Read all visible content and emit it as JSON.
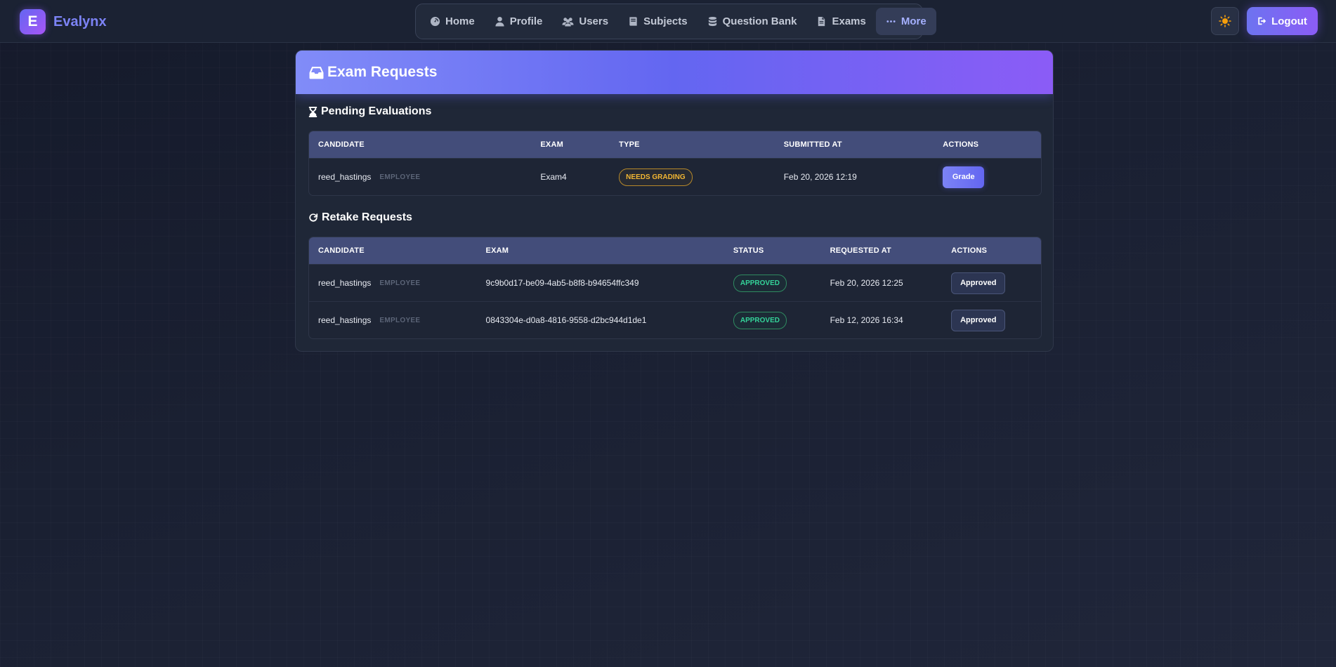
{
  "app": {
    "logo_letter": "E",
    "name": "Evalynx"
  },
  "nav": {
    "items": [
      {
        "label": "Home",
        "icon": "gauge-icon"
      },
      {
        "label": "Profile",
        "icon": "user-icon"
      },
      {
        "label": "Users",
        "icon": "users-icon"
      },
      {
        "label": "Subjects",
        "icon": "book-icon"
      },
      {
        "label": "Question Bank",
        "icon": "database-icon"
      },
      {
        "label": "Exams",
        "icon": "file-icon"
      },
      {
        "label": "More",
        "icon": "ellipsis-icon",
        "active": true
      }
    ]
  },
  "header_actions": {
    "theme_icon": "sun-icon",
    "logout_label": "Logout"
  },
  "page": {
    "title": "Exam Requests"
  },
  "pending": {
    "title": "Pending Evaluations",
    "columns": [
      "CANDIDATE",
      "EXAM",
      "TYPE",
      "SUBMITTED AT",
      "ACTIONS"
    ],
    "rows": [
      {
        "candidate": "reed_hastings",
        "role": "EMPLOYEE",
        "exam": "Exam4",
        "type": "NEEDS GRADING",
        "submitted_at": "Feb 20, 2026 12:19",
        "action": "Grade"
      }
    ]
  },
  "retake": {
    "title": "Retake Requests",
    "columns": [
      "CANDIDATE",
      "EXAM",
      "STATUS",
      "REQUESTED AT",
      "ACTIONS"
    ],
    "rows": [
      {
        "candidate": "reed_hastings",
        "role": "EMPLOYEE",
        "exam": "9c9b0d17-be09-4ab5-b8f8-b94654ffc349",
        "status": "APPROVED",
        "requested_at": "Feb 20, 2026 12:25",
        "action": "Approved"
      },
      {
        "candidate": "reed_hastings",
        "role": "EMPLOYEE",
        "exam": "0843304e-d0a8-4816-9558-d2bc944d1de1",
        "status": "APPROVED",
        "requested_at": "Feb 12, 2026 16:34",
        "action": "Approved"
      }
    ]
  },
  "colors": {
    "accent": "#6366f1",
    "accent_purple": "#8b5cf6",
    "warning": "#f2b633",
    "success": "#34d399",
    "background": "#1a2032"
  }
}
